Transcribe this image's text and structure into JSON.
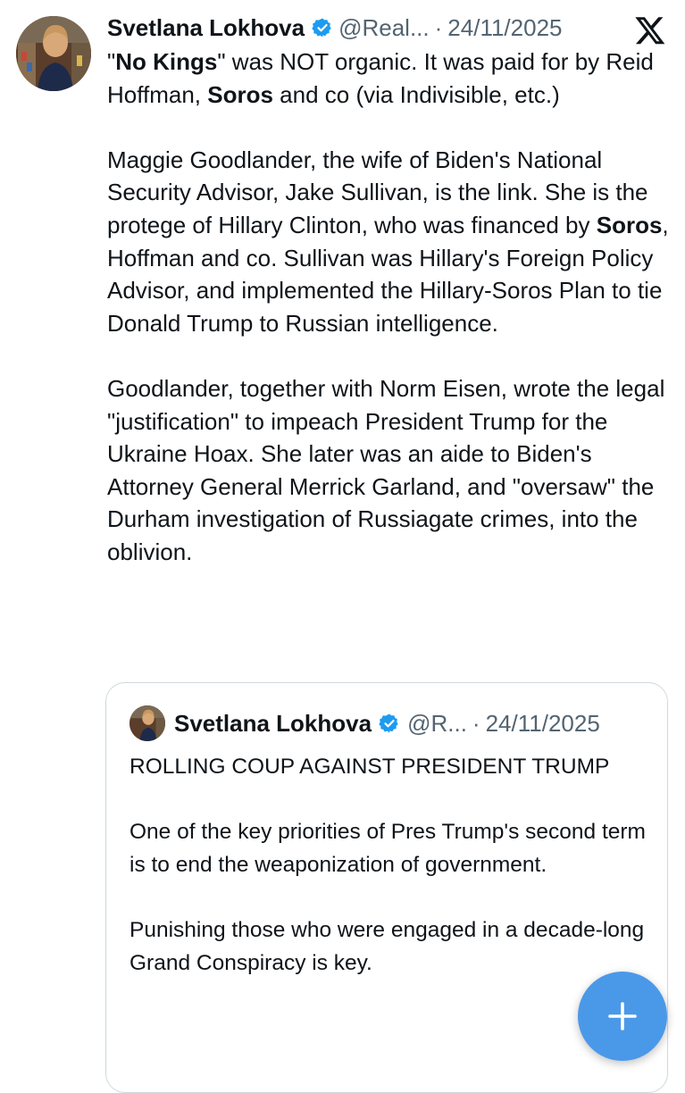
{
  "post": {
    "author_name": "Svetlana Lokhova",
    "handle": "@Real...",
    "separator": "·",
    "date": "24/11/2025",
    "paragraphs": [
      [
        {
          "text": "\"",
          "bold": false
        },
        {
          "text": "No Kings",
          "bold": true
        },
        {
          "text": "\" was NOT organic. It was paid for by Reid Hoffman, ",
          "bold": false
        },
        {
          "text": "Soros",
          "bold": true
        },
        {
          "text": " and co (via Indivisible, etc.)",
          "bold": false
        }
      ],
      [
        {
          "text": "Maggie Goodlander, the wife of Biden's National Security Advisor, Jake Sullivan, is the link. She is the protege of Hillary Clinton, who was financed by ",
          "bold": false
        },
        {
          "text": "Soros",
          "bold": true
        },
        {
          "text": ",  Hoffman and co. Sullivan was Hillary's Foreign Policy Advisor, and implemented the Hillary-Soros Plan to tie Donald Trump to Russian intelligence.",
          "bold": false
        }
      ],
      [
        {
          "text": "Goodlander, together with Norm Eisen, wrote the legal \"justification\" to impeach President Trump for the Ukraine Hoax. She later was an aide to Biden's Attorney General Merrick Garland, and \"oversaw\" the Durham investigation of Russiagate crimes, into the oblivion.",
          "bold": false
        }
      ]
    ]
  },
  "quoted": {
    "author_name": "Svetlana Lokhova",
    "handle": "@R...",
    "separator": "·",
    "date": "24/11/2025",
    "paragraphs": [
      "ROLLING COUP AGAINST PRESIDENT TRUMP",
      "One of the key priorities of Pres Trump's second term is to end the weaponization of government.",
      "Punishing those who were engaged in a decade-long Grand Conspiracy is key."
    ]
  },
  "colors": {
    "verified": "#1d9bf0",
    "fab": "#4a99e9",
    "muted": "#536471",
    "border": "#cfd9de"
  },
  "icons": {
    "verified": "verified-badge-icon",
    "platform": "x-logo-icon",
    "compose": "plus-icon"
  }
}
